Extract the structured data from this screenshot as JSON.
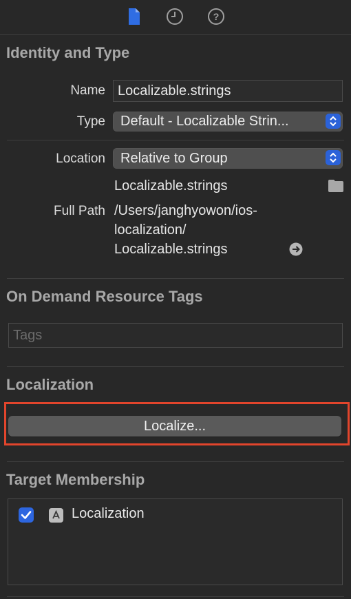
{
  "toolbar": {
    "tabs": [
      {
        "icon": "file-icon",
        "selected": true
      },
      {
        "icon": "history-clock-icon",
        "selected": false
      },
      {
        "icon": "help-question-icon",
        "selected": false
      }
    ]
  },
  "identity": {
    "title": "Identity and Type",
    "name_label": "Name",
    "name_value": "Localizable.strings",
    "type_label": "Type",
    "type_value": "Default - Localizable Strin...",
    "location_label": "Location",
    "location_value": "Relative to Group",
    "file_name": "Localizable.strings",
    "full_path_label": "Full Path",
    "full_path_line1": "/Users/janghyowon/ios-",
    "full_path_line2": "localization/",
    "full_path_line3": "Localizable.strings"
  },
  "on_demand": {
    "title": "On Demand Resource Tags",
    "tags_placeholder": "Tags"
  },
  "localization": {
    "title": "Localization",
    "button_label": "Localize..."
  },
  "target_membership": {
    "title": "Target Membership",
    "targets": [
      {
        "label": "Localization",
        "checked": true
      }
    ]
  },
  "colors": {
    "background": "#282828",
    "accent": "#2d66e0",
    "highlight": "#e2452c"
  }
}
